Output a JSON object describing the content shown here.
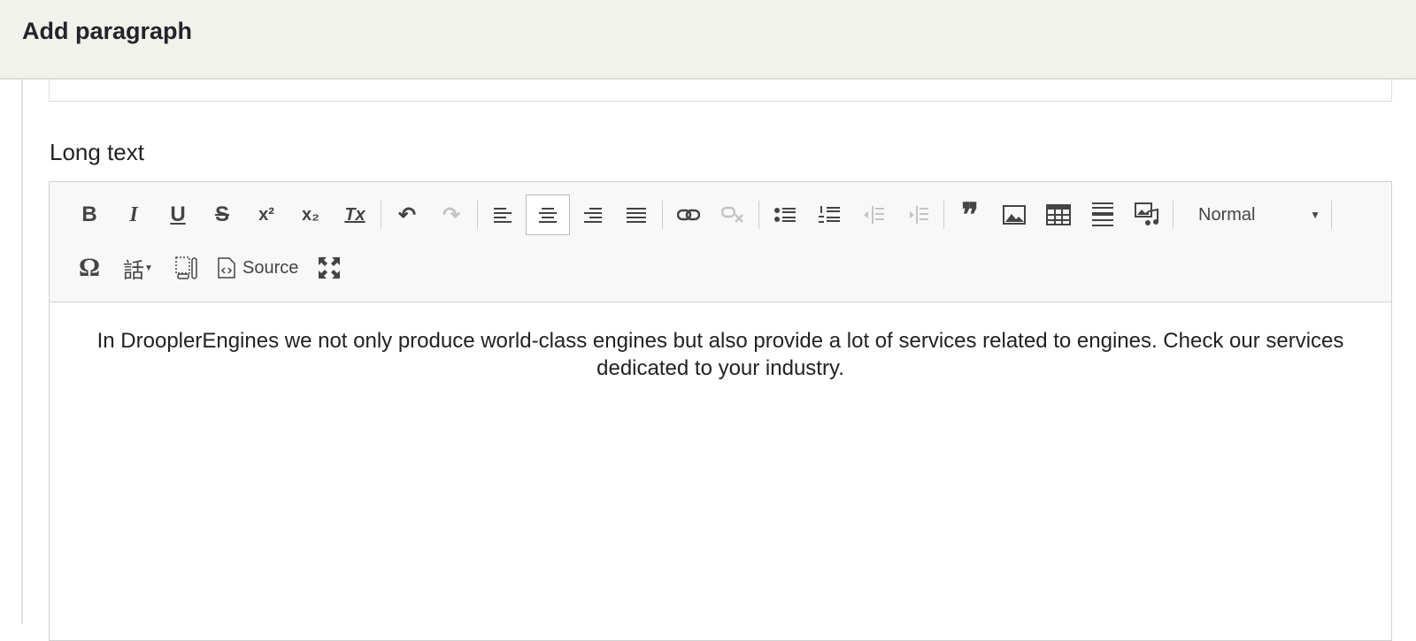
{
  "header": {
    "title": "Add paragraph"
  },
  "field": {
    "label": "Long text"
  },
  "toolbar": {
    "format_value": "Normal",
    "source_label": "Source",
    "icons": {
      "bold": "B",
      "italic": "I",
      "underline": "U",
      "strike": "S",
      "superscript": "x²",
      "subscript": "x₂",
      "remove_format": "Tx",
      "undo": "↶",
      "redo": "↷",
      "blockquote": "❞",
      "special_char": "Ω",
      "language": "話"
    }
  },
  "editor": {
    "content": "In DrooplerEngines we not only produce world-class engines but also provide a lot of services related to engines. Check our services dedicated to your industry."
  }
}
